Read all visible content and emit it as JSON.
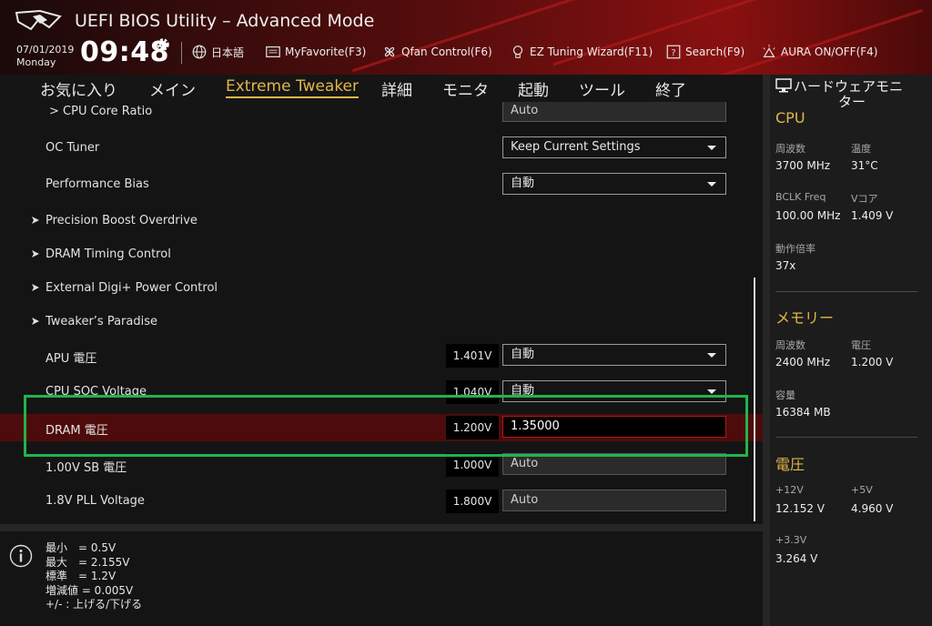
{
  "header": {
    "title": "UEFI BIOS Utility – Advanced Mode",
    "date": "07/01/2019",
    "day": "Monday",
    "time": "09:48",
    "items": [
      {
        "label": "日本語",
        "icon": "globe-icon"
      },
      {
        "label": "MyFavorite(F3)",
        "icon": "favorite-list-icon"
      },
      {
        "label": "Qfan Control(F6)",
        "icon": "fan-icon"
      },
      {
        "label": "EZ Tuning Wizard(F11)",
        "icon": "lightbulb-icon"
      },
      {
        "label": "Search(F9)",
        "icon": "search-help-icon"
      },
      {
        "label": "AURA ON/OFF(F4)",
        "icon": "aura-icon"
      }
    ]
  },
  "nav": {
    "tabs": [
      "お気に入り",
      "メイン",
      "Extreme Tweaker",
      "詳細",
      "モニタ",
      "起動",
      "ツール",
      "終了"
    ],
    "active": "Extreme Tweaker"
  },
  "settings": [
    {
      "label": "> CPU Core Ratio",
      "value": "Auto"
    },
    {
      "label": "OC Tuner",
      "value": "Keep Current Settings"
    },
    {
      "label": "Performance Bias",
      "value": "自動"
    },
    {
      "label": "Precision Boost Overdrive"
    },
    {
      "label": "DRAM Timing Control"
    },
    {
      "label": "External Digi+ Power Control"
    },
    {
      "label": "Tweaker’s Paradise"
    },
    {
      "label": "APU 電圧",
      "voltage": "1.401V",
      "value": "自動"
    },
    {
      "label": "CPU SOC Voltage",
      "voltage": "1.040V",
      "value": "自動"
    },
    {
      "label": "DRAM 電圧",
      "voltage": "1.200V",
      "value": "1.35000"
    },
    {
      "label": "1.00V SB 電圧",
      "voltage": "1.000V",
      "value": "Auto"
    },
    {
      "label": "1.8V PLL Voltage",
      "voltage": "1.800V",
      "value": "Auto"
    }
  ],
  "help": {
    "lines": [
      "最小　= 0.5V",
      "最大　= 2.155V",
      "標準　= 1.2V",
      "増減値 = 0.005V",
      "+/- : 上げる/下げる"
    ]
  },
  "monitor": {
    "title_line1": "ハードウェアモニ",
    "title_line2": "ター",
    "cpu": {
      "heading": "CPU",
      "freq_label": "周波数",
      "freq": "3700 MHz",
      "temp_label": "温度",
      "temp": "31°C",
      "bclk_label": "BCLK Freq",
      "bclk": "100.00 MHz",
      "vcore_label": "Vコア",
      "vcore": "1.409 V",
      "ratio_label": "動作倍率",
      "ratio": "37x"
    },
    "memory": {
      "heading": "メモリー",
      "freq_label": "周波数",
      "freq": "2400 MHz",
      "volt_label": "電圧",
      "volt": "1.200 V",
      "cap_label": "容量",
      "cap": "16384 MB"
    },
    "voltage": {
      "heading": "電圧",
      "v12_label": "+12V",
      "v12": "12.152 V",
      "v5_label": "+5V",
      "v5": "4.960 V",
      "v33_label": "+3.3V",
      "v33": "3.264 V"
    }
  },
  "colors": {
    "accent": "#e0b64a",
    "highlight_row": "#4e0b0b",
    "focus_box": "#22b34a",
    "input_border": "#b01818"
  }
}
